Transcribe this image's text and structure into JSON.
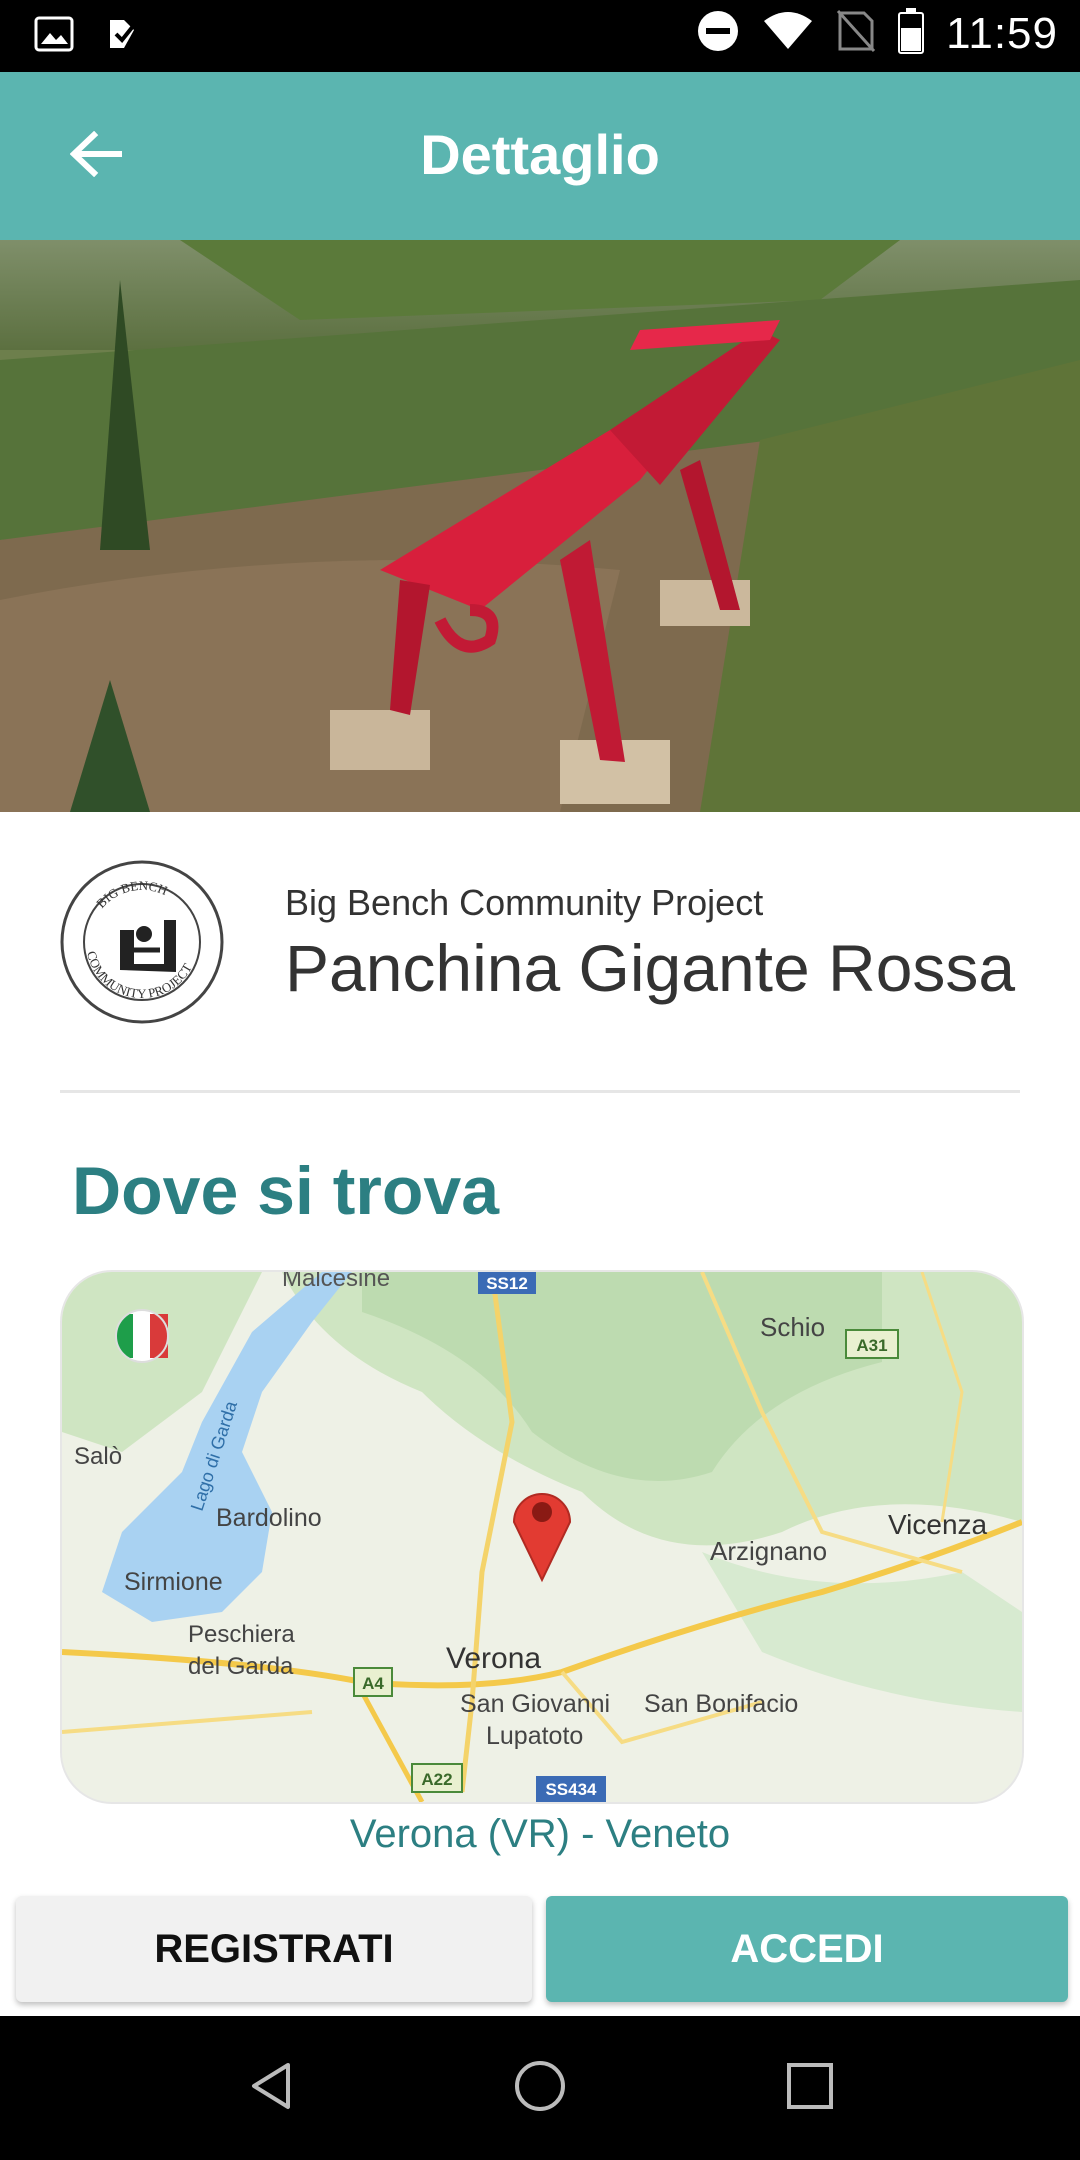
{
  "status_bar": {
    "time": "11:59",
    "left_icons": [
      "image-icon",
      "checkmark-notification-icon"
    ],
    "right_icons": [
      "do-not-disturb-icon",
      "wifi-icon",
      "no-sim-icon",
      "battery-icon"
    ]
  },
  "app_bar": {
    "title": "Dettaglio",
    "back_icon": "arrow-left-icon",
    "background_color": "#5bb5b0"
  },
  "bench": {
    "organization": "Big Bench Community Project",
    "name": "Panchina Gigante Rossa",
    "logo_text": "BIG BENCH COMMUNITY PROJECT"
  },
  "location_section": {
    "title": "Dove si trova",
    "place": "Verona (VR) - Veneto"
  },
  "map": {
    "labels": {
      "malcesine": "Malcesine",
      "schio": "Schio",
      "salo": "Salò",
      "lago": "Lago di Garda",
      "bardolino": "Bardolino",
      "sirmione": "Sirmione",
      "peschiera": "Peschiera",
      "del_garda": "del Garda",
      "verona": "Verona",
      "arzignano": "Arzignano",
      "vicenza": "Vicenza",
      "san_giovanni": "San Giovanni",
      "lupatoto": "Lupatoto",
      "san_bonifacio": "San Bonifacio"
    },
    "road_badges": {
      "ss12": "SS12",
      "a31": "A31",
      "a4": "A4",
      "a22": "A22",
      "ss434": "SS434"
    }
  },
  "buttons": {
    "register": "REGISTRATI",
    "login": "ACCEDI"
  },
  "colors": {
    "accent": "#5bb5b0",
    "heading": "#2c7f82",
    "bench_red": "#e0223a"
  },
  "nav_bar": [
    "back-triangle-icon",
    "home-circle-icon",
    "recents-square-icon"
  ]
}
